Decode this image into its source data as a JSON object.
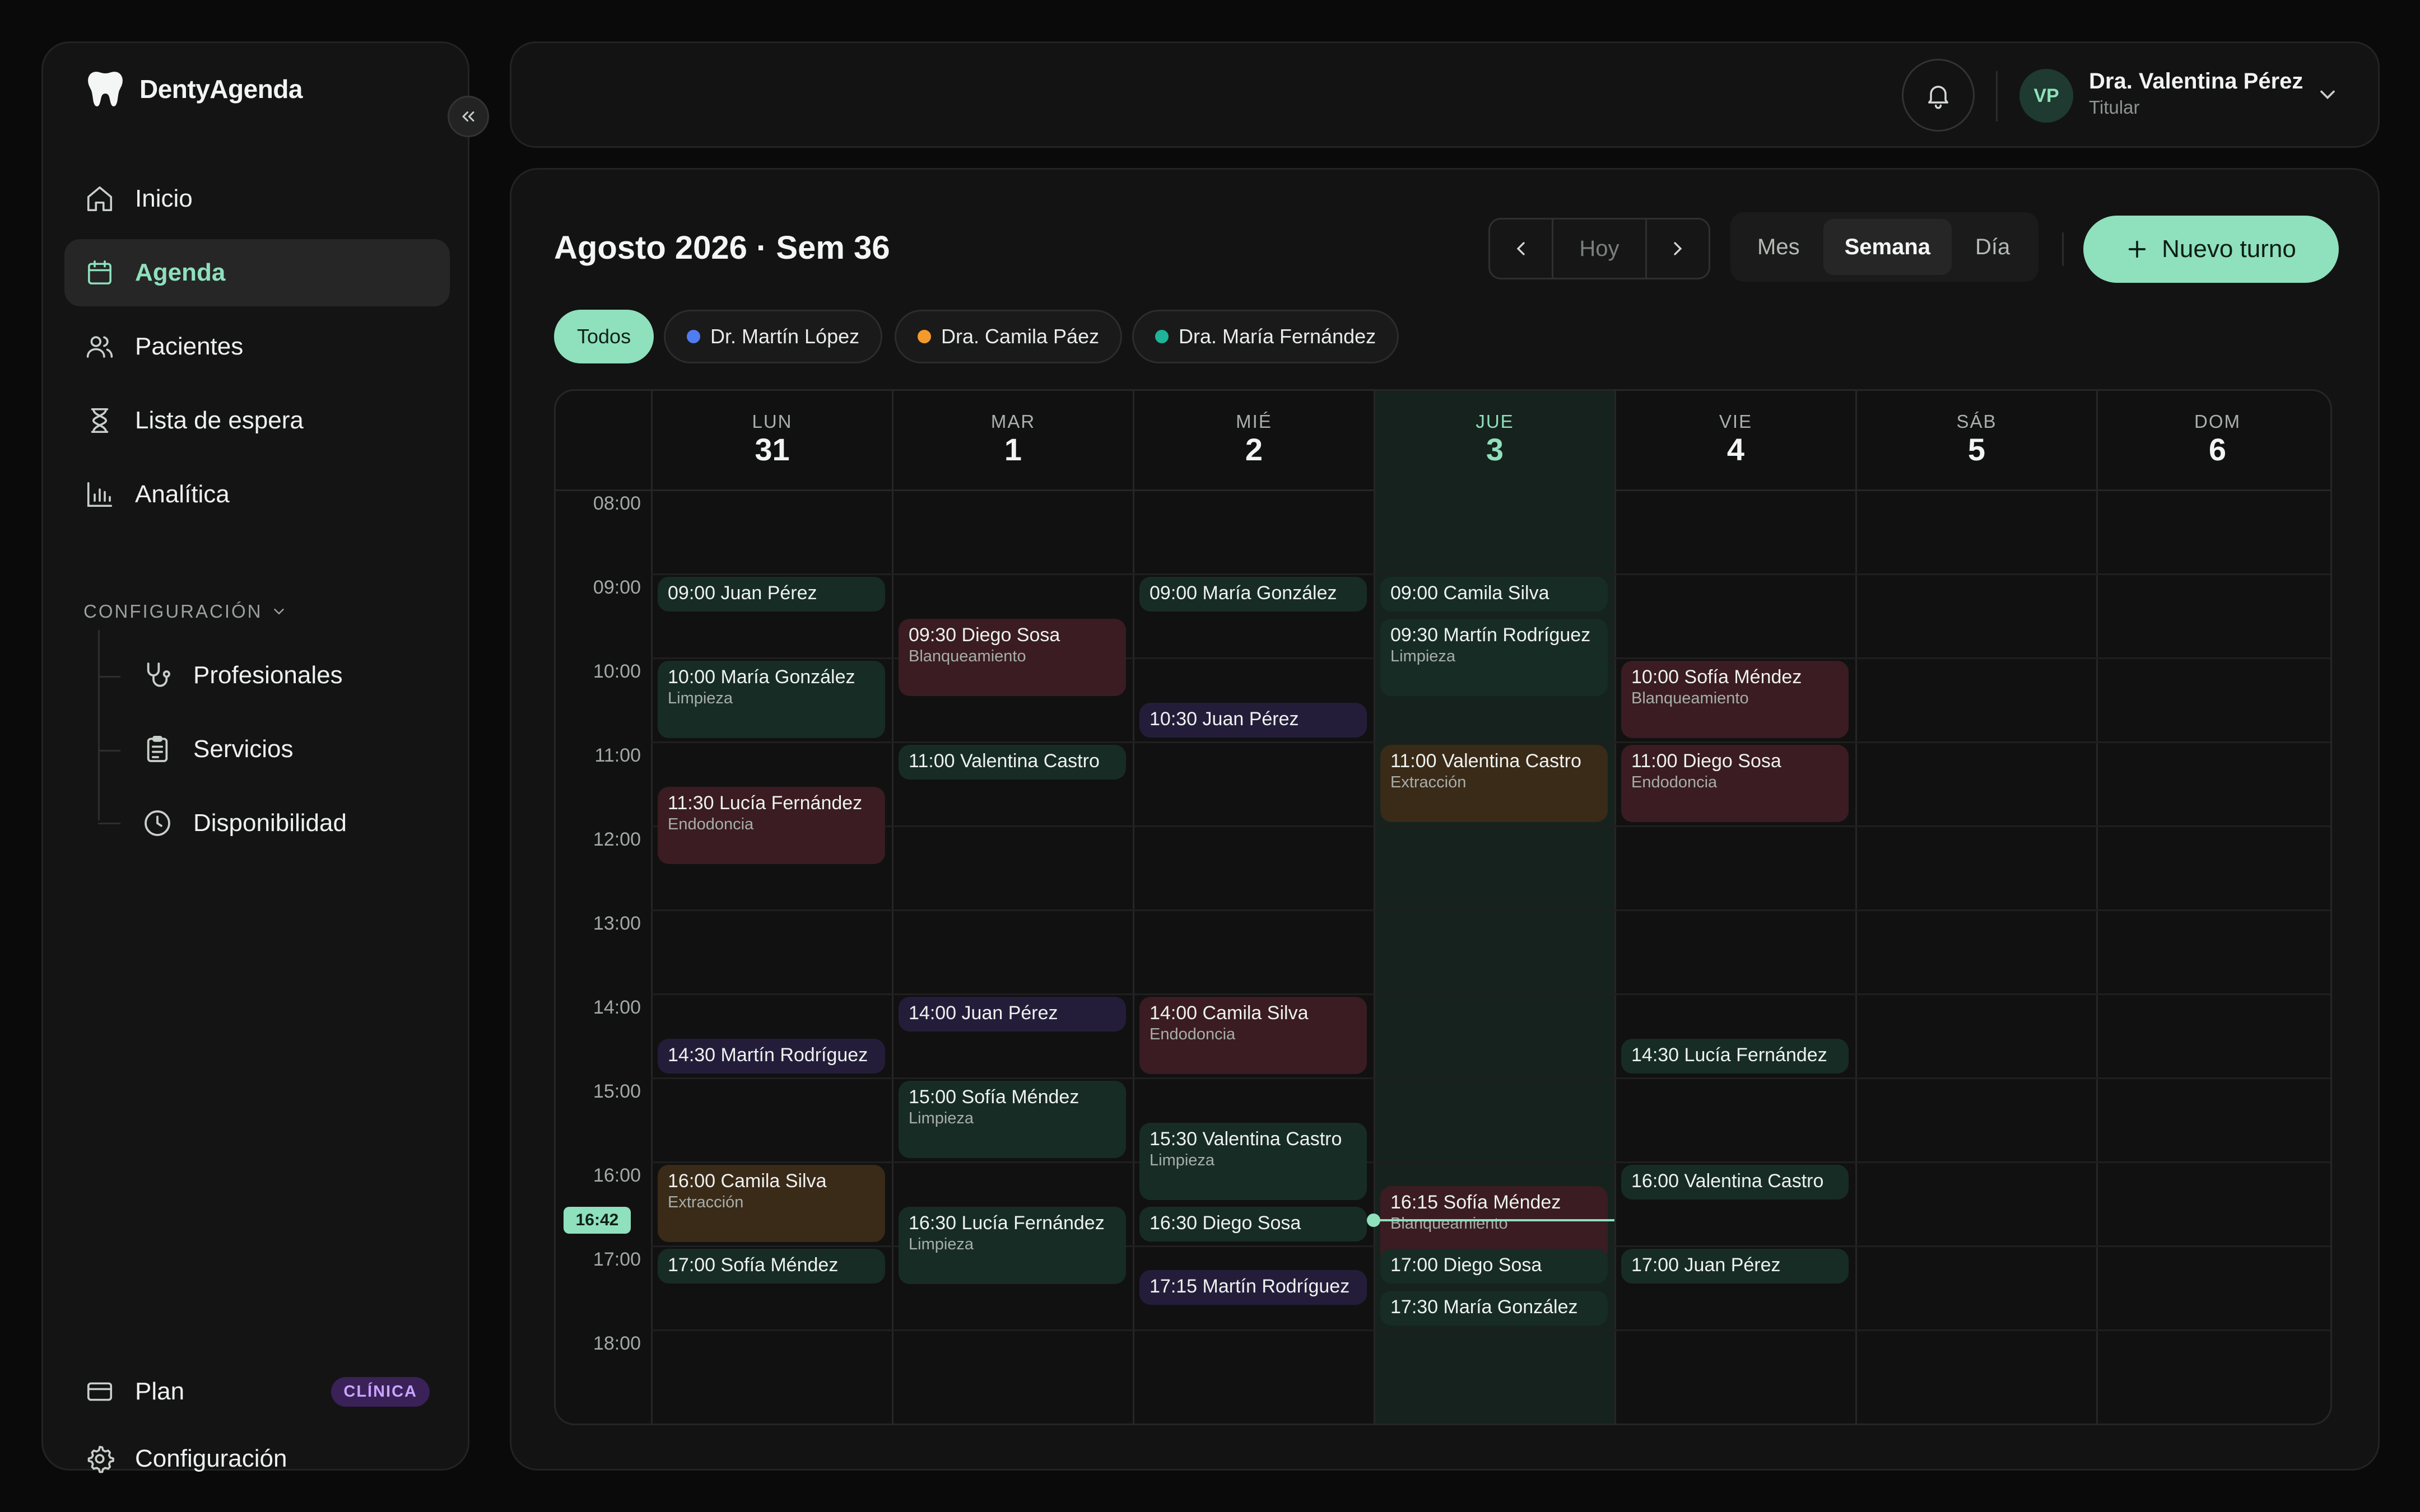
{
  "brand": {
    "name": "DentyAgenda"
  },
  "sidebar": {
    "nav": [
      {
        "label": "Inicio",
        "icon": "home-icon"
      },
      {
        "label": "Agenda",
        "icon": "calendar-icon",
        "active": true
      },
      {
        "label": "Pacientes",
        "icon": "users-icon"
      },
      {
        "label": "Lista de espera",
        "icon": "hourglass-icon"
      },
      {
        "label": "Analítica",
        "icon": "bar-chart-icon"
      }
    ],
    "config_section": "CONFIGURACIÓN",
    "config_items": [
      {
        "label": "Profesionales",
        "icon": "stethoscope-icon"
      },
      {
        "label": "Servicios",
        "icon": "clipboard-icon"
      },
      {
        "label": "Disponibilidad",
        "icon": "clock-icon"
      }
    ],
    "plan": {
      "label": "Plan",
      "badge": "CLÍNICA"
    },
    "settings": {
      "label": "Configuración"
    }
  },
  "topbar": {
    "user": {
      "initials": "VP",
      "name": "Dra. Valentina Pérez",
      "role": "Titular"
    }
  },
  "header": {
    "title": "Agosto 2026 · Sem 36",
    "today_label": "Hoy",
    "views": [
      "Mes",
      "Semana",
      "Día"
    ],
    "active_view": "Semana",
    "new_button": "Nuevo turno"
  },
  "filters": [
    {
      "label": "Todos",
      "active": true
    },
    {
      "label": "Dr. Martín López",
      "color": "#4f7cf0"
    },
    {
      "label": "Dra. Camila Páez",
      "color": "#f59a2a"
    },
    {
      "label": "Dra. María Fernández",
      "color": "#1fb39a"
    }
  ],
  "calendar": {
    "days": [
      {
        "name": "LUN",
        "num": "31"
      },
      {
        "name": "MAR",
        "num": "1"
      },
      {
        "name": "MIÉ",
        "num": "2"
      },
      {
        "name": "JUE",
        "num": "3",
        "today": true
      },
      {
        "name": "VIE",
        "num": "4"
      },
      {
        "name": "SÁB",
        "num": "5"
      },
      {
        "name": "DOM",
        "num": "6"
      }
    ],
    "hours": [
      "08:00",
      "09:00",
      "10:00",
      "11:00",
      "12:00",
      "13:00",
      "14:00",
      "15:00",
      "16:00",
      "17:00",
      "18:00"
    ],
    "now": "16:42",
    "events": [
      {
        "day": 0,
        "start": "09:00",
        "title": "09:00 Juan Pérez",
        "color": "green"
      },
      {
        "day": 0,
        "start": "10:00",
        "title": "10:00 María González",
        "sub": "Limpieza",
        "color": "green"
      },
      {
        "day": 0,
        "start": "11:30",
        "title": "11:30 Lucía Fernández",
        "sub": "Endodoncia",
        "color": "red"
      },
      {
        "day": 0,
        "start": "14:30",
        "title": "14:30 Martín Rodríguez",
        "color": "purple"
      },
      {
        "day": 0,
        "start": "16:00",
        "title": "16:00 Camila Silva",
        "sub": "Extracción",
        "color": "orange"
      },
      {
        "day": 0,
        "start": "17:00",
        "title": "17:00 Sofía Méndez",
        "color": "green"
      },
      {
        "day": 1,
        "start": "09:30",
        "title": "09:30 Diego Sosa",
        "sub": "Blanqueamiento",
        "color": "red"
      },
      {
        "day": 1,
        "start": "11:00",
        "title": "11:00 Valentina Castro",
        "color": "green"
      },
      {
        "day": 1,
        "start": "14:00",
        "title": "14:00 Juan Pérez",
        "color": "purple"
      },
      {
        "day": 1,
        "start": "15:00",
        "title": "15:00 Sofía Méndez",
        "sub": "Limpieza",
        "color": "green"
      },
      {
        "day": 1,
        "start": "16:30",
        "title": "16:30 Lucía Fernández",
        "sub": "Limpieza",
        "color": "green"
      },
      {
        "day": 2,
        "start": "09:00",
        "title": "09:00 María González",
        "color": "green"
      },
      {
        "day": 2,
        "start": "10:30",
        "title": "10:30 Juan Pérez",
        "color": "purple"
      },
      {
        "day": 2,
        "start": "14:00",
        "title": "14:00 Camila Silva",
        "sub": "Endodoncia",
        "color": "red"
      },
      {
        "day": 2,
        "start": "15:30",
        "title": "15:30 Valentina Castro",
        "sub": "Limpieza",
        "color": "green"
      },
      {
        "day": 2,
        "start": "16:30",
        "title": "16:30 Diego Sosa",
        "color": "green"
      },
      {
        "day": 2,
        "start": "17:15",
        "title": "17:15 Martín Rodríguez",
        "color": "purple"
      },
      {
        "day": 3,
        "start": "09:00",
        "title": "09:00 Camila Silva",
        "color": "green"
      },
      {
        "day": 3,
        "start": "09:30",
        "title": "09:30 Martín Rodríguez",
        "sub": "Limpieza",
        "color": "green"
      },
      {
        "day": 3,
        "start": "11:00",
        "title": "11:00 Valentina Castro",
        "sub": "Extracción",
        "color": "orange"
      },
      {
        "day": 3,
        "start": "16:15",
        "title": "16:15 Sofía Méndez",
        "sub": "Blanqueamiento",
        "color": "red"
      },
      {
        "day": 3,
        "start": "17:00",
        "title": "17:00 Diego Sosa",
        "color": "green"
      },
      {
        "day": 3,
        "start": "17:30",
        "title": "17:30 María González",
        "color": "green"
      },
      {
        "day": 4,
        "start": "10:00",
        "title": "10:00 Sofía Méndez",
        "sub": "Blanqueamiento",
        "color": "red"
      },
      {
        "day": 4,
        "start": "11:00",
        "title": "11:00 Diego Sosa",
        "sub": "Endodoncia",
        "color": "red"
      },
      {
        "day": 4,
        "start": "14:30",
        "title": "14:30 Lucía Fernández",
        "color": "green"
      },
      {
        "day": 4,
        "start": "16:00",
        "title": "16:00 Valentina Castro",
        "color": "green"
      },
      {
        "day": 4,
        "start": "17:00",
        "title": "17:00 Juan Pérez",
        "color": "green"
      }
    ]
  }
}
